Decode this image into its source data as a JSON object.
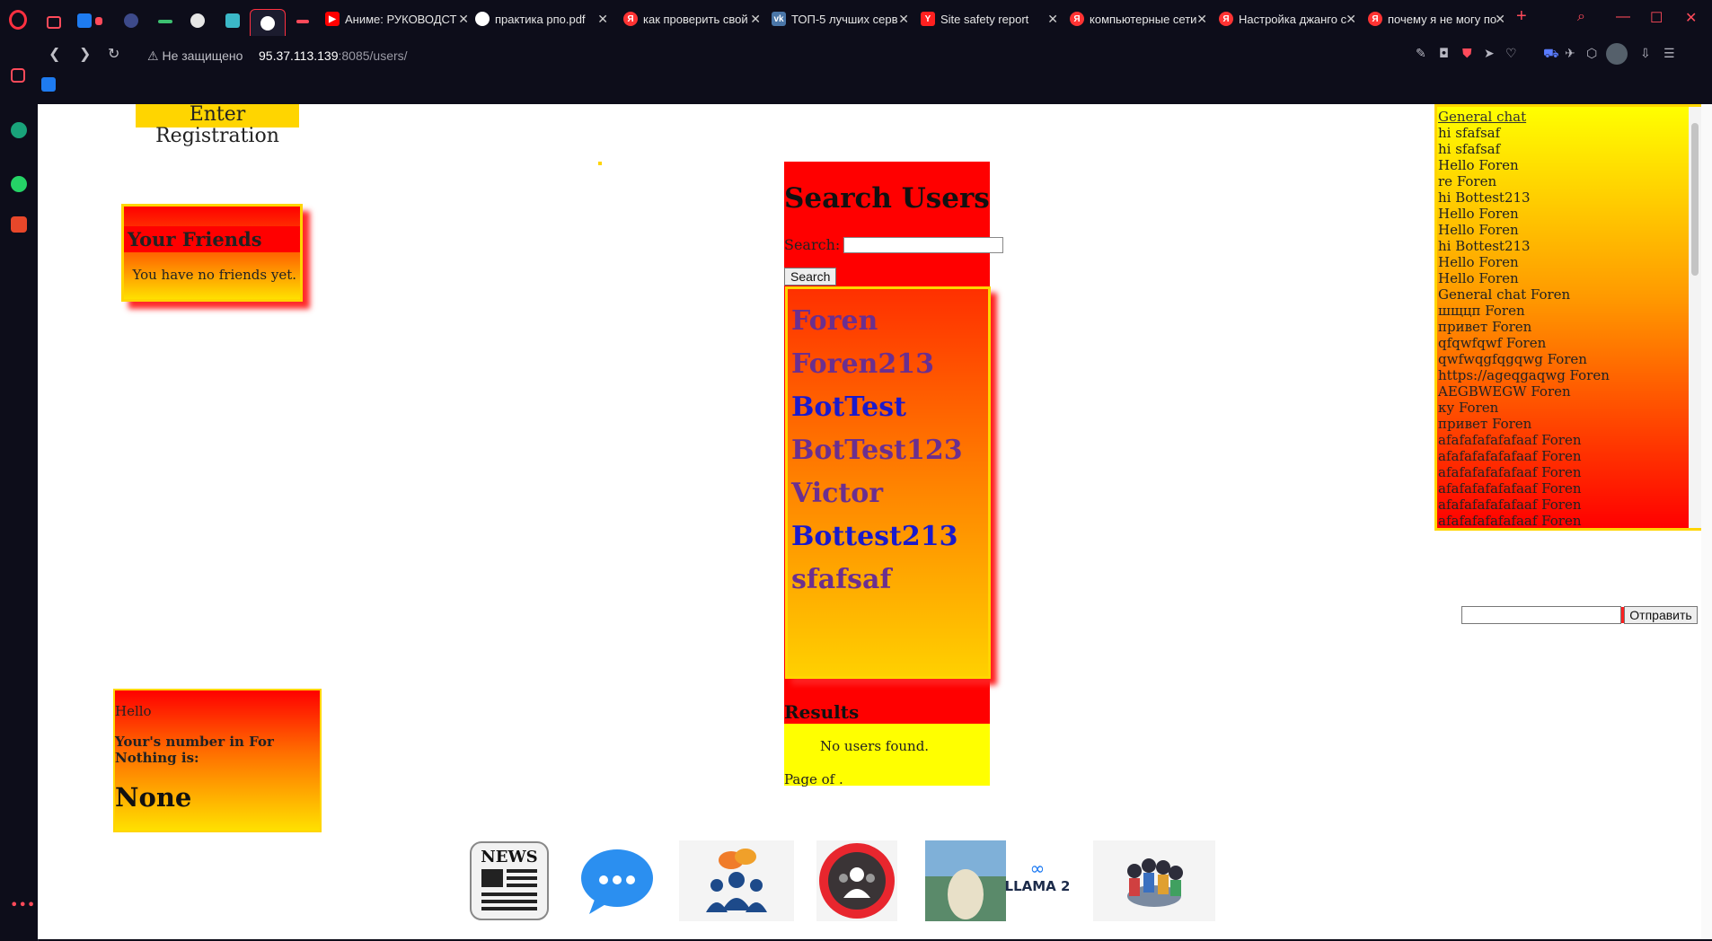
{
  "browser": {
    "tabs": [
      {
        "label": "",
        "favicon": "youtube",
        "color": "#ff0000"
      },
      {
        "label": "Аниме: РУКОВОДСТ",
        "favicon": "youtube",
        "color": "#ff0000"
      },
      {
        "label": "практика pпо.pdf",
        "favicon": "globe",
        "color": "#cccccc"
      },
      {
        "label": "как проверить свой",
        "favicon": "yandex",
        "color": "#ff3333"
      },
      {
        "label": "ТОП-5 лучших серв",
        "favicon": "vk",
        "color": "#4a76a8"
      },
      {
        "label": "Site safety report",
        "favicon": "yandex-y",
        "color": "#ff2020"
      },
      {
        "label": "компьютерные сети",
        "favicon": "yandex",
        "color": "#ff3333"
      },
      {
        "label": "Настройка джанго с",
        "favicon": "yandex",
        "color": "#ff3333"
      },
      {
        "label": "почему я не могу по",
        "favicon": "yandex",
        "color": "#ff3333"
      }
    ],
    "security_label": "Не защищено",
    "url_host": "95.37.113.139",
    "url_rest": ":8085/users/"
  },
  "page": {
    "top_link": "Enter Registration",
    "friends": {
      "title": "Your Friends",
      "empty_text": "You have no friends yet."
    },
    "search": {
      "title": "Search Users",
      "label": "Search:",
      "input_value": "",
      "button_label": "Search"
    },
    "users": [
      {
        "name": "Foren",
        "color": "#6b2f8f"
      },
      {
        "name": "Foren213",
        "color": "#6b2f8f"
      },
      {
        "name": "BotTest",
        "color": "#1a1acc"
      },
      {
        "name": "BotTest123",
        "color": "#6b2f8f"
      },
      {
        "name": "Victor",
        "color": "#6b2f8f"
      },
      {
        "name": "Bottest213",
        "color": "#1a1acc"
      },
      {
        "name": "sfafsaf",
        "color": "#6b2f8f"
      }
    ],
    "results": {
      "title": "Results",
      "empty_text": "No users found.",
      "pager": "Page of ."
    },
    "number_box": {
      "greeting": "Hello",
      "label": "Your's number in For Nothing is:",
      "value": "None"
    },
    "chat": {
      "title": "General chat",
      "messages": [
        "hi sfafsaf",
        "hi sfafsaf",
        "Hello Foren",
        "re Foren",
        "hi Bottest213",
        "Hello Foren",
        "Hello Foren",
        "hi Bottest213",
        "Hello Foren",
        "Hello Foren",
        "General chat Foren",
        "шщцп Foren",
        "привет Foren",
        "qfqwfqwf Foren",
        "qwfwqgfqgqwg Foren",
        "https://ageqgaqwg Foren",
        "AEGBWEGW Foren",
        "ку Foren",
        "привет Foren",
        "afafafafafafaaf Foren",
        "afafafafafafaaf Foren",
        "afafafafafafaaf Foren",
        "afafafafafafaaf Foren",
        "afafafafafafaaf Foren",
        "afafafafafafaaf Foren"
      ],
      "input_value": "",
      "send_label": "Отправить"
    },
    "apps": [
      {
        "name": "news-app-icon",
        "text": "NEWS"
      },
      {
        "name": "messages-app-icon",
        "text": ""
      },
      {
        "name": "group-chat-app-icon",
        "text": ""
      },
      {
        "name": "community-app-icon",
        "text": ""
      },
      {
        "name": "llama-app-icon",
        "text": "LLAMA 2"
      },
      {
        "name": "people-app-icon",
        "text": ""
      }
    ]
  }
}
